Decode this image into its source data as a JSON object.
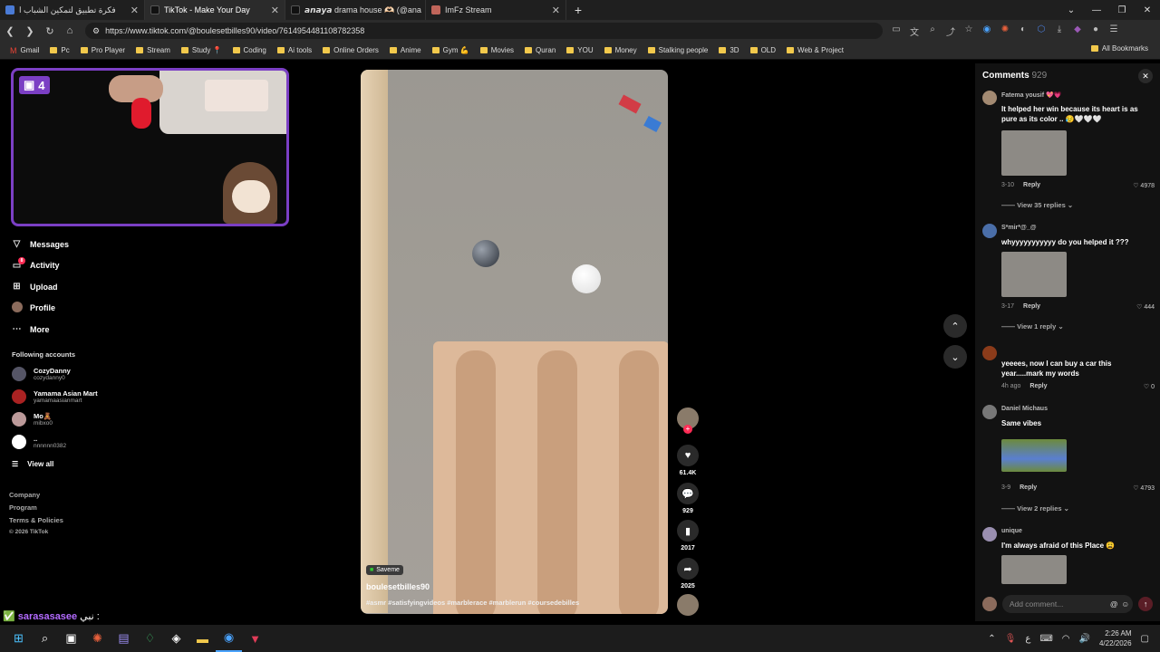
{
  "browser": {
    "tabs": [
      {
        "title": "فكرة تطبيق لتمكين الشباب ا",
        "active": false,
        "icon": "sparkle-icon",
        "color": "#4a7bd6"
      },
      {
        "title": "TikTok - Make Your Day",
        "active": true,
        "icon": "tiktok-icon",
        "color": "#111111"
      },
      {
        "title": "𝙖𝙣𝙖𝙮𝙖 drama house 🫶🏻 (@ana",
        "active": false,
        "icon": "tiktok-icon",
        "color": "#111111"
      },
      {
        "title": "ImFz Stream",
        "active": false,
        "icon": "stream-icon",
        "color": "#c0655a"
      }
    ],
    "url": "https://www.tiktok.com/@boulesetbilles90/video/7614954481108782358",
    "bookmarks": [
      "Gmail",
      "Pc",
      "Pro Player",
      "Stream",
      "Study 📍",
      "Coding",
      "Ai tools",
      "Online Orders",
      "Anime",
      "Gym 💪",
      "Movies",
      "Quran",
      "YOU",
      "Money",
      "Stalking people",
      "3D",
      "OLD",
      "Web & Project"
    ],
    "all_bookmarks": "All Bookmarks"
  },
  "stream_overlay": {
    "viewer_count": "4"
  },
  "sidebar": {
    "items": [
      {
        "label": "Messages",
        "icon": "send-icon"
      },
      {
        "label": "Activity",
        "icon": "inbox-icon",
        "badge": "8"
      },
      {
        "label": "Upload",
        "icon": "plus-square-icon"
      },
      {
        "label": "Profile",
        "icon": "avatar-icon"
      },
      {
        "label": "More",
        "icon": "more-icon"
      }
    ],
    "following_title": "Following accounts",
    "accounts": [
      {
        "name": "CozyDanny",
        "handle": "cozydanny0"
      },
      {
        "name": "Yamama Asian Mart",
        "handle": "yamamaasianmart"
      },
      {
        "name": "Mo🧸",
        "handle": "mibxo0"
      },
      {
        "name": "..",
        "handle": "nnnnnn0382"
      }
    ],
    "view_all": "View all",
    "footer": [
      "Company",
      "Program",
      "Terms & Policies",
      "© 2026 TikTok"
    ]
  },
  "chat_overlay": {
    "username": "sarasasasee",
    "message": "نبي :"
  },
  "video": {
    "badge": "Saveme",
    "author": "boulesetbilles90",
    "caption": "#asmr #satisfyingvideos #marblerace #marblerun #coursedebilles"
  },
  "actions": {
    "likes": "61.4K",
    "comments": "929",
    "saves": "2017",
    "shares": "2025"
  },
  "comments_panel": {
    "title": "Comments",
    "count": "929",
    "add_placeholder": "Add comment...",
    "items": [
      {
        "user": "Fatema yousif 💖💗",
        "text": "It helped her win because its heart is as pure as its color .. 😥🤍🤍🤍",
        "date": "3-10",
        "reply": "Reply",
        "likes": "4978",
        "more": "View 35 replies ⌄",
        "has_image": true
      },
      {
        "user": "S*mir*@_@",
        "text": "whyyyyyyyyyyy do you helped it ???",
        "date": "3-17",
        "reply": "Reply",
        "likes": "444",
        "more": "View 1 reply ⌄",
        "has_image": true
      },
      {
        "user": "",
        "text": "yeeees, now I can buy a car this year.....mark my words",
        "date": "4h ago",
        "reply": "Reply",
        "likes": "0",
        "more": "",
        "has_image": false
      },
      {
        "user": "Daniel Michaus",
        "text": "Same vibes",
        "date": "3-9",
        "reply": "Reply",
        "likes": "4793",
        "more": "View 2 replies ⌄",
        "has_image": true
      },
      {
        "user": "unique",
        "text": "I'm always afraid of this Place 😩",
        "date": "",
        "reply": "",
        "likes": "",
        "more": "",
        "has_image": true
      }
    ]
  },
  "taskbar": {
    "time": "2:26 AM",
    "date": "4/22/2026",
    "lang": "ع"
  },
  "colors": {
    "accent": "#fe2c55",
    "stream_border": "#7b3fc4"
  }
}
